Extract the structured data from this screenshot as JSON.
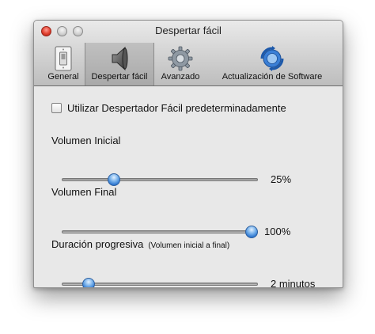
{
  "window": {
    "title": "Despertar fácil"
  },
  "toolbar": {
    "tabs": [
      {
        "label": "General",
        "icon": "light-switch-icon",
        "selected": false
      },
      {
        "label": "Despertar fácil",
        "icon": "speaker-icon",
        "selected": true
      },
      {
        "label": "Avanzado",
        "icon": "gear-icon",
        "selected": false
      },
      {
        "label": "Actualización de Software",
        "icon": "software-update-icon",
        "selected": false
      }
    ]
  },
  "settings": {
    "default_checkbox": {
      "label": "Utilizar Despertador Fácil predeterminadamente",
      "checked": false
    },
    "initial_volume": {
      "label": "Volumen Inicial",
      "value_text": "25%",
      "fraction": 0.25
    },
    "final_volume": {
      "label": "Volumen Final",
      "value_text": "100%",
      "fraction": 1.0
    },
    "duration": {
      "label": "Duración progresiva",
      "hint": "(Volumen inicial a final)",
      "value_text": "2 minutos",
      "fraction": 0.11
    }
  },
  "colors": {
    "accent": "#2f78d0",
    "close_button": "#e0402f"
  }
}
